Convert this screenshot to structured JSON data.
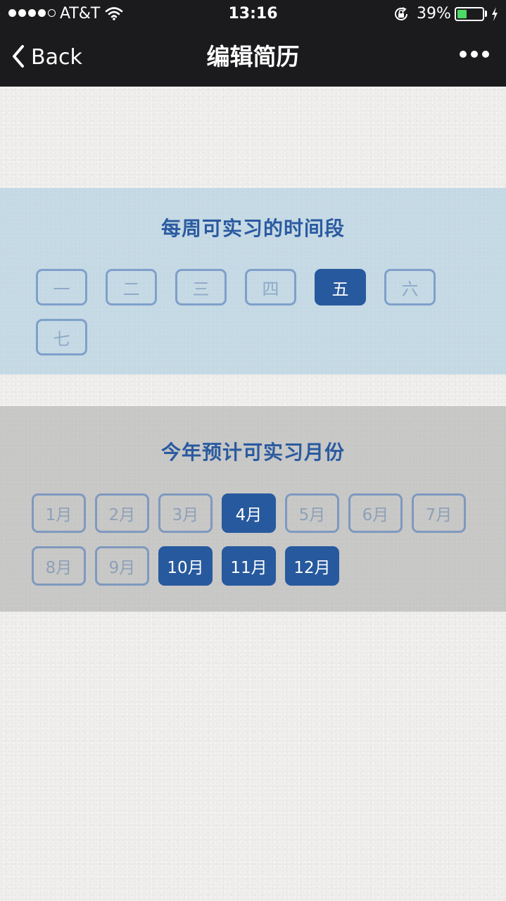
{
  "status_bar": {
    "carrier": "AT&T",
    "time": "13:16",
    "battery_percent": "39%",
    "battery_level": 0.39,
    "signal_bars_filled": 4,
    "signal_bars_total": 5,
    "icons": [
      "wifi-icon",
      "orientation-lock-icon",
      "battery-icon",
      "charging-bolt-icon"
    ]
  },
  "nav": {
    "back_label": "Back",
    "title": "编辑简历",
    "more_icon": "more-dots-icon",
    "back_icon": "chevron-left-icon"
  },
  "weekdays_section": {
    "title": "每周可实习的时间段",
    "days": [
      {
        "label": "一",
        "selected": false
      },
      {
        "label": "二",
        "selected": false
      },
      {
        "label": "三",
        "selected": false
      },
      {
        "label": "四",
        "selected": false
      },
      {
        "label": "五",
        "selected": true
      },
      {
        "label": "六",
        "selected": false
      },
      {
        "label": "七",
        "selected": false
      }
    ]
  },
  "months_section": {
    "title": "今年预计可实习月份",
    "months": [
      {
        "label": "1月",
        "selected": false
      },
      {
        "label": "2月",
        "selected": false
      },
      {
        "label": "3月",
        "selected": false
      },
      {
        "label": "4月",
        "selected": true
      },
      {
        "label": "5月",
        "selected": false
      },
      {
        "label": "6月",
        "selected": false
      },
      {
        "label": "7月",
        "selected": false
      },
      {
        "label": "8月",
        "selected": false
      },
      {
        "label": "9月",
        "selected": false
      },
      {
        "label": "10月",
        "selected": true
      },
      {
        "label": "11月",
        "selected": true
      },
      {
        "label": "12月",
        "selected": true
      }
    ]
  },
  "colors": {
    "nav_background": "#1b1b1d",
    "selected_chip": "#27599e",
    "section_title": "#2a5aa0",
    "battery_fill": "#4cd964"
  }
}
